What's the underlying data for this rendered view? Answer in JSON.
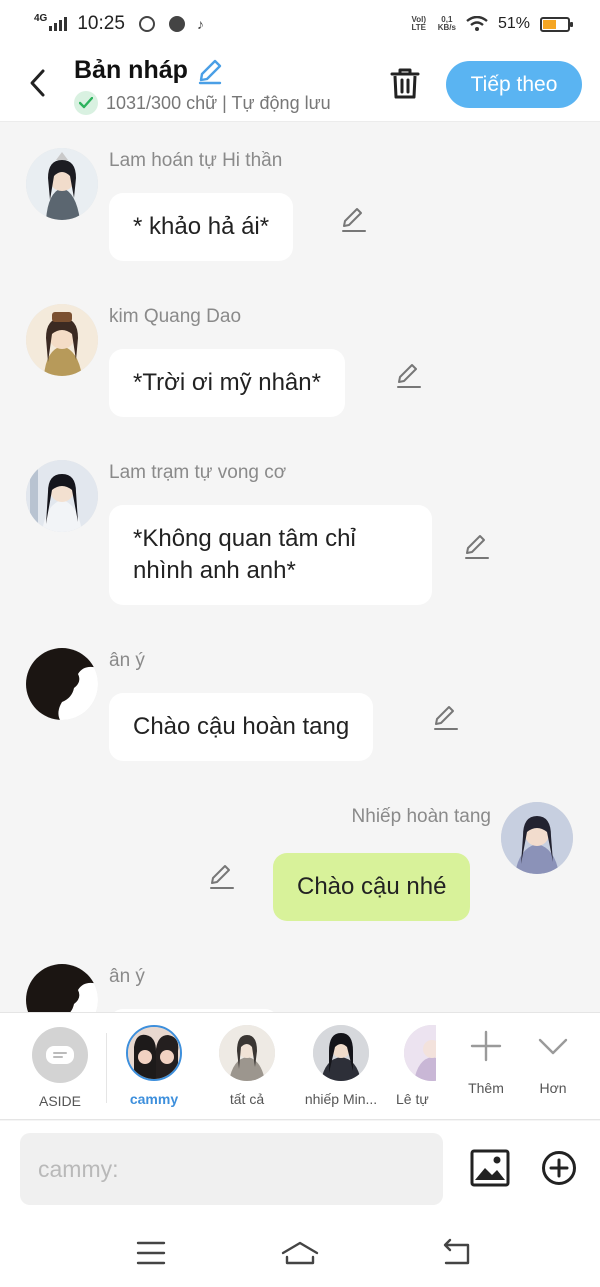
{
  "status_bar": {
    "network": "4G",
    "time": "10:25",
    "volte": "Vol) LTE",
    "speed_value": "0,1",
    "speed_unit": "KB/s",
    "battery": "51%",
    "battery_level": 0.51
  },
  "header": {
    "title": "Bản nháp",
    "word_count": "1031/300 chữ | Tự động lưu",
    "next_label": "Tiếp theo"
  },
  "messages": [
    {
      "sender": "Lam hoán tự Hi thần",
      "text": "* khảo hả ái*"
    },
    {
      "sender": "kim Quang Dao",
      "text": "*Trời ơi mỹ nhân*"
    },
    {
      "sender": "Lam trạm tự vong cơ",
      "text": "*Không quan tâm chỉ nhình anh anh*"
    },
    {
      "sender": "ân ý",
      "text": "Chào cậu hoàn tang"
    },
    {
      "sender": "Nhiếp hoàn tang",
      "text": "Chào cậu nhé"
    },
    {
      "sender": "ân ý",
      "text": ""
    }
  ],
  "characters": {
    "aside": "ASIDE",
    "items": [
      "cammy",
      "tất cả",
      "nhiếp Min...",
      "Lê tự"
    ],
    "add_label": "Thêm",
    "more_label": "Hơn"
  },
  "input": {
    "placeholder": "cammy:"
  },
  "colors": {
    "accent": "#5ab4f2",
    "own_bubble": "#d8f29a",
    "active_character": "#3d8fdc"
  }
}
